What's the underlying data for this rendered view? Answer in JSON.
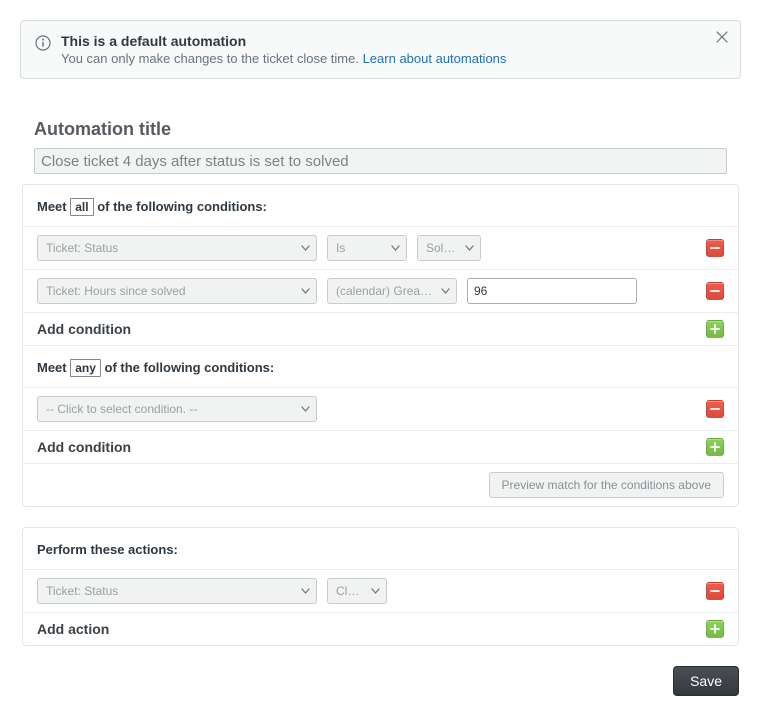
{
  "callout": {
    "title": "This is a default automation",
    "subtitle_lead": "You can only make changes to the ticket close time. ",
    "link_label": "Learn about automations"
  },
  "title_section": {
    "heading": "Automation title",
    "input_value": "Close ticket 4 days after status is set to solved"
  },
  "conditions": {
    "all": {
      "heading_pre": "Meet ",
      "heading_box": "all",
      "heading_post": " of the following conditions:",
      "rows": [
        {
          "field": "Ticket: Status",
          "operator": "Is",
          "value_select": "Solved"
        },
        {
          "field": "Ticket: Hours since solved",
          "operator": "(calendar) Greater than",
          "value_input": "96"
        }
      ],
      "add_label": "Add condition"
    },
    "any": {
      "heading_pre": "Meet ",
      "heading_box": "any",
      "heading_post": " of the following conditions:",
      "rows": [
        {
          "field": "-- Click to select condition. --"
        }
      ],
      "add_label": "Add condition"
    },
    "preview_label": "Preview match for the conditions above"
  },
  "actions": {
    "heading": "Perform these actions:",
    "rows": [
      {
        "field": "Ticket: Status",
        "value_select": "Closed"
      }
    ],
    "add_label": "Add action"
  },
  "footer": {
    "save_label": "Save"
  }
}
